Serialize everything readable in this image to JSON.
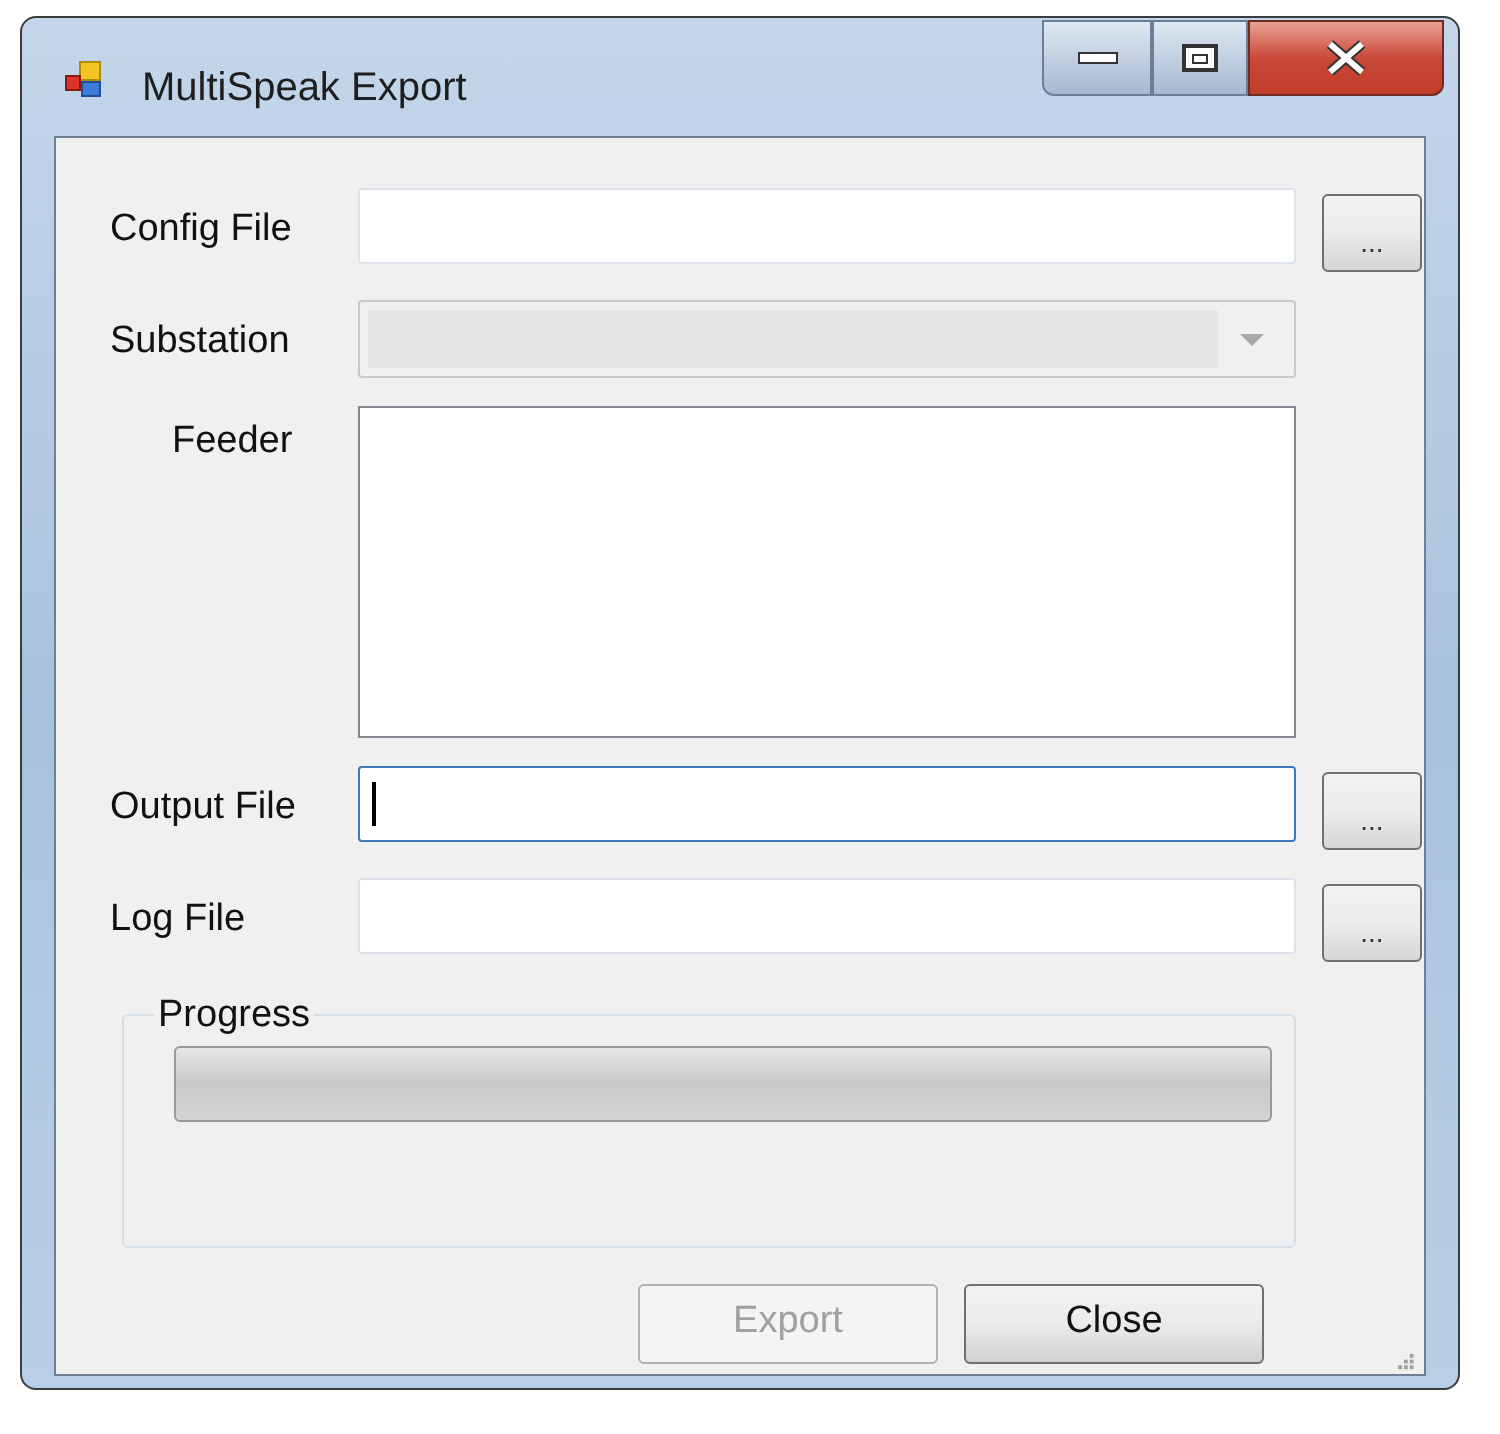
{
  "window": {
    "title": "MultiSpeak Export"
  },
  "fields": [
    {
      "kind": "text",
      "label": "Config File",
      "browse": "...",
      "focused": false
    },
    {
      "kind": "combo",
      "label": "Substation",
      "disabled": true
    },
    {
      "kind": "list",
      "label": "Feeder"
    },
    {
      "kind": "text",
      "label": "Output File",
      "browse": "...",
      "focused": true
    },
    {
      "kind": "text",
      "label": "Log File",
      "browse": "...",
      "focused": false
    }
  ],
  "progress": {
    "title": "Progress",
    "level": 0
  },
  "buttons": [
    {
      "label": "Export",
      "disabled": true
    },
    {
      "label": "Close",
      "disabled": false
    }
  ]
}
